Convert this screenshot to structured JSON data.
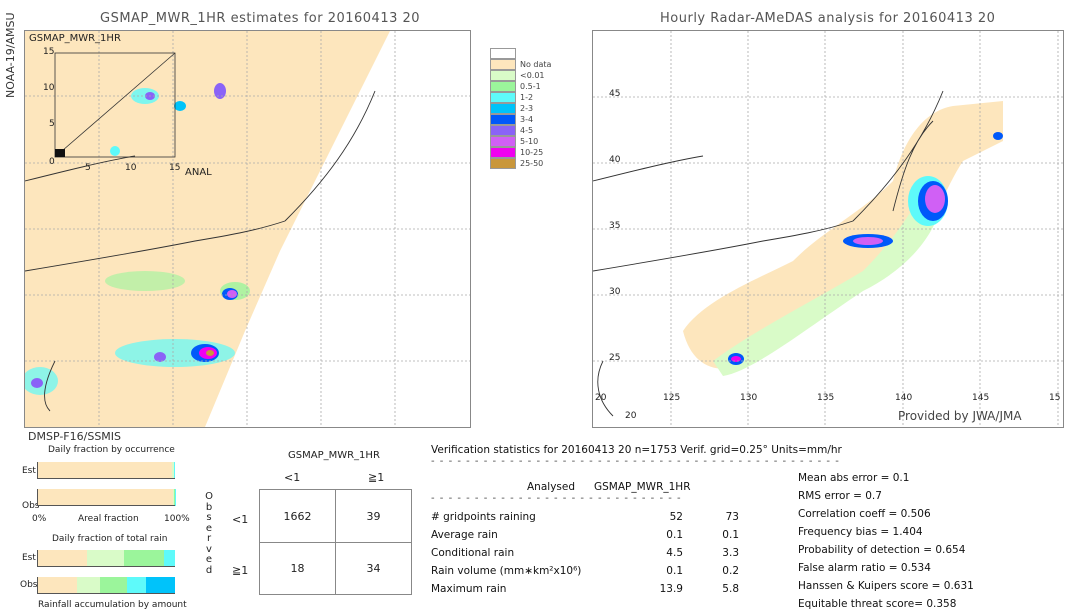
{
  "satellite_label": "NOAA-19/AMSU",
  "left_map": {
    "title": "GSMAP_MWR_1HR estimates for 20160413 20",
    "inset": {
      "title": "GSMAP_MWR_1HR",
      "x_label": "ANAL",
      "x_ticks": [
        "0",
        "5",
        "10",
        "15"
      ],
      "y_ticks": [
        "0",
        "5",
        "10",
        "15"
      ]
    }
  },
  "right_map": {
    "title": "Hourly Radar-AMeDAS analysis for 20160413 20",
    "lat_ticks": [
      "45",
      "40",
      "35",
      "30",
      "25",
      "20"
    ],
    "lon_ticks": [
      "125",
      "130",
      "135",
      "140",
      "145",
      "15"
    ],
    "corner_labels": [
      "20",
      "20"
    ],
    "credit": "Provided by JWA/JMA"
  },
  "legend": [
    {
      "label": "",
      "color": "#ffffff"
    },
    {
      "label": "No data",
      "color": "#fde6bd"
    },
    {
      "label": "<0.01",
      "color": "#d9fbc8"
    },
    {
      "label": "0.5-1",
      "color": "#9bf59b"
    },
    {
      "label": "1-2",
      "color": "#5efafa"
    },
    {
      "label": "2-3",
      "color": "#00c3fa"
    },
    {
      "label": "3-4",
      "color": "#0059fa"
    },
    {
      "label": "4-5",
      "color": "#8a63f7"
    },
    {
      "label": "5-10",
      "color": "#d060f5"
    },
    {
      "label": "10-25",
      "color": "#f000f0"
    },
    {
      "label": "25-50",
      "color": "#c9973b"
    }
  ],
  "occurrence": {
    "sensor": "DMSP-F16/SSMIS",
    "title": "Daily fraction by occurrence",
    "rows": [
      "Est",
      "Obs"
    ],
    "x_left": "0%",
    "x_mid": "Areal fraction",
    "x_right": "100%"
  },
  "total_rain": {
    "title": "Daily fraction of total rain",
    "rows": [
      "Est",
      "Obs"
    ],
    "footer": "Rainfall accumulation by amount"
  },
  "chart_data": [
    {
      "type": "bar",
      "title": "Daily fraction by occurrence",
      "orientation": "horizontal-stacked",
      "categories": [
        "Est",
        "Obs"
      ],
      "xlabel": "Areal fraction",
      "xlim": [
        0,
        100
      ],
      "series": [
        {
          "name": "No data",
          "color": "#fde6bd",
          "values": [
            98.0,
            98.6
          ]
        },
        {
          "name": "<0.01",
          "color": "#d9fbc8",
          "values": [
            1.0,
            0.7
          ]
        },
        {
          "name": "0.5-1",
          "color": "#9bf59b",
          "values": [
            0.6,
            0.4
          ]
        },
        {
          "name": "1-2",
          "color": "#5efafa",
          "values": [
            0.4,
            0.3
          ]
        }
      ]
    },
    {
      "type": "bar",
      "title": "Daily fraction of total rain",
      "orientation": "horizontal-stacked",
      "categories": [
        "Est",
        "Obs"
      ],
      "xlabel": "Rainfall accumulation by amount",
      "xlim": [
        0,
        100
      ],
      "series": [
        {
          "name": "<0.01",
          "color": "#fde6bd",
          "values": [
            36,
            29
          ]
        },
        {
          "name": "0.5-1",
          "color": "#d9fbc8",
          "values": [
            27,
            17
          ]
        },
        {
          "name": "1-2",
          "color": "#9bf59b",
          "values": [
            29,
            19
          ]
        },
        {
          "name": "2-3",
          "color": "#5efafa",
          "values": [
            8,
            14
          ]
        },
        {
          "name": "3-4",
          "color": "#00c3fa",
          "values": [
            0,
            21
          ]
        }
      ]
    },
    {
      "type": "table",
      "title": "GSMAP_MWR_1HR",
      "row_axis_label": "Observed",
      "columns": [
        "<1",
        "≧1"
      ],
      "rows": [
        "<1",
        "≧1"
      ],
      "values": [
        [
          1662,
          39
        ],
        [
          18,
          34
        ]
      ]
    }
  ],
  "contingency": {
    "title": "GSMAP_MWR_1HR",
    "row_axis_label": [
      "O",
      "b",
      "s",
      "e",
      "r",
      "v",
      "e",
      "d"
    ],
    "col_headers": [
      "<1",
      "≧1"
    ],
    "row_headers": [
      "<1",
      "≧1"
    ],
    "cells": [
      [
        "1662",
        "39"
      ],
      [
        "18",
        "34"
      ]
    ]
  },
  "verification": {
    "header": "Verification statistics for 20160413 20   n=1753   Verif. grid=0.25°   Units=mm/hr",
    "col_analysed": "Analysed",
    "col_estimate": "GSMAP_MWR_1HR",
    "rows": [
      {
        "label": "# gridpoints raining",
        "analysed": "52",
        "estimate": "73"
      },
      {
        "label": "Average rain",
        "analysed": "0.1",
        "estimate": "0.1"
      },
      {
        "label": "Conditional rain",
        "analysed": "4.5",
        "estimate": "3.3"
      },
      {
        "label": "Rain volume (mm∗km²x10⁶)",
        "analysed": "0.1",
        "estimate": "0.2"
      },
      {
        "label": "Maximum rain",
        "analysed": "13.9",
        "estimate": "5.8"
      }
    ],
    "scores": [
      "Mean abs error = 0.1",
      "RMS error = 0.7",
      "Correlation coeff = 0.506",
      "Frequency bias = 1.404",
      "Probability of detection = 0.654",
      "False alarm ratio = 0.534",
      "Hanssen & Kuipers score = 0.631",
      "Equitable threat score= 0.358"
    ]
  }
}
